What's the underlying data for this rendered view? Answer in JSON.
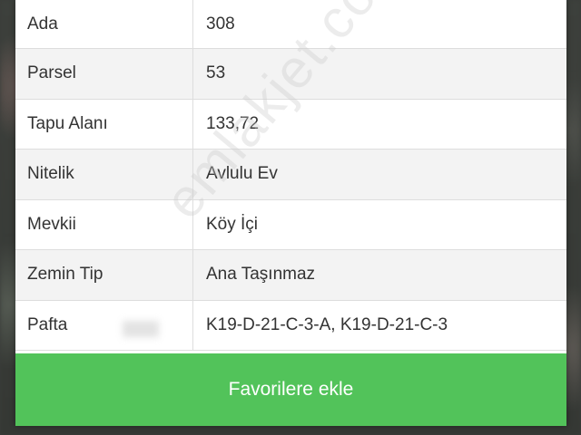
{
  "details": {
    "rows": [
      {
        "label": "Ada",
        "value": "308"
      },
      {
        "label": "Parsel",
        "value": "53"
      },
      {
        "label": "Tapu Alanı",
        "value": "133,72"
      },
      {
        "label": "Nitelik",
        "value": "Avlulu Ev"
      },
      {
        "label": "Mevkii",
        "value": "Köy İçi"
      },
      {
        "label": "Zemin Tip",
        "value": "Ana Taşınmaz"
      },
      {
        "label": "Pafta",
        "value": "K19-D-21-C-3-A, K19-D-21-C-3"
      }
    ]
  },
  "actions": {
    "favorite_label": "Favorilere ekle"
  },
  "watermark": {
    "text": "emlakjet.com"
  },
  "colors": {
    "accent": "#52c35a"
  }
}
